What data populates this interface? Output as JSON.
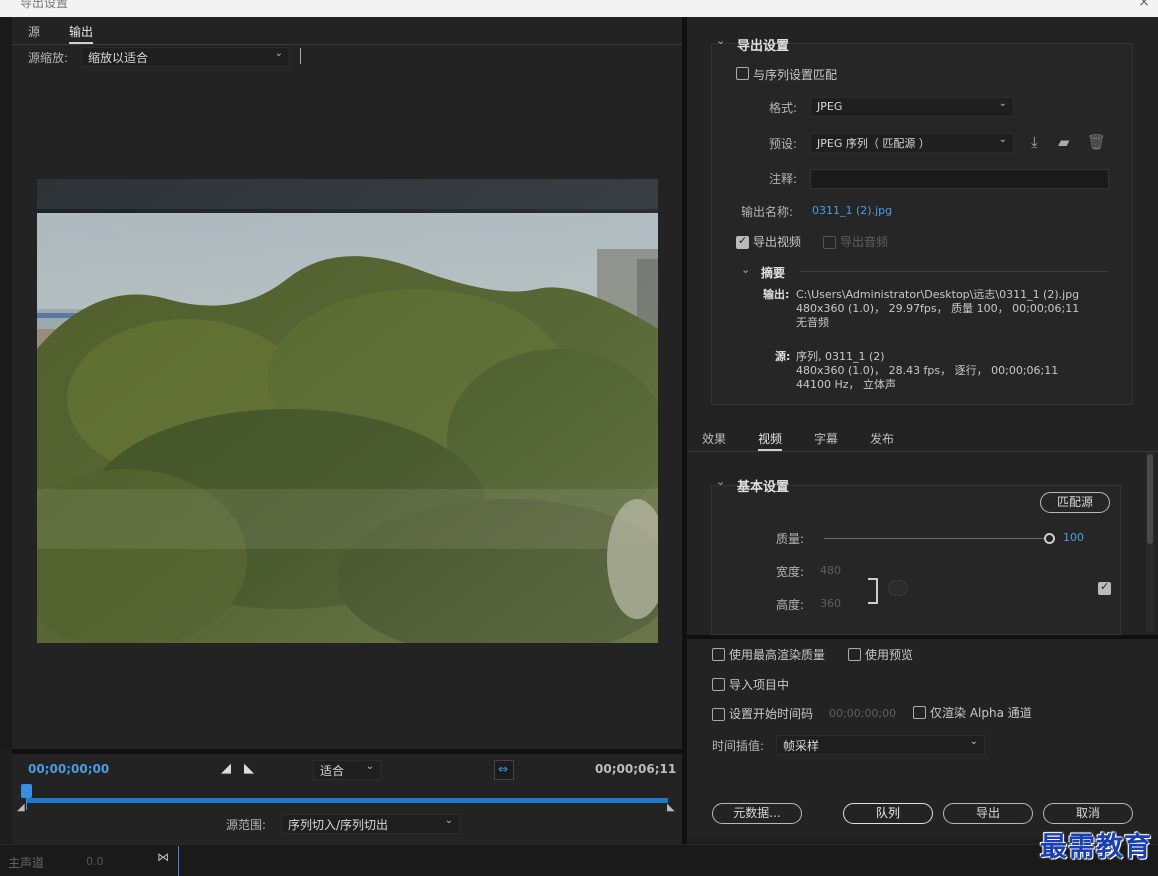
{
  "window": {
    "title": "导出设置",
    "close": "×"
  },
  "left": {
    "tabs": [
      "源",
      "输出"
    ],
    "source_scale_label": "源缩放:",
    "source_scale_value": "缩放以适合",
    "timecode_start": "00;00;00;00",
    "timecode_end": "00;00;06;11",
    "fit_value": "适合",
    "range_label": "源范围:",
    "range_value": "序列切入/序列切出"
  },
  "export": {
    "section_title": "导出设置",
    "match_sequence": "与序列设置匹配",
    "format_label": "格式:",
    "format_value": "JPEG",
    "preset_label": "预设:",
    "preset_value": "JPEG 序列（ 匹配源 ）",
    "comment_label": "注释:",
    "output_name_label": "输出名称:",
    "output_name_value": "0311_1 (2).jpg",
    "export_video": "导出视频",
    "export_audio": "导出音频",
    "summary_title": "摘要",
    "summary_output_label": "输出:",
    "summary_output_line1": "C:\\Users\\Administrator\\Desktop\\远志\\0311_1  (2).jpg",
    "summary_output_line2": "480x360  (1.0)， 29.97fps， 质量 100， 00;00;06;11",
    "summary_output_line3": "无音频",
    "summary_source_label": "源:",
    "summary_source_line1": "序列, 0311_1 (2)",
    "summary_source_line2": "480x360  (1.0)， 28.43  fps， 逐行， 00;00;06;11",
    "summary_source_line3": "44100 Hz， 立体声"
  },
  "settings_tabs": [
    "效果",
    "视频",
    "字幕",
    "发布"
  ],
  "basic": {
    "title": "基本设置",
    "match_source_btn": "匹配源",
    "quality_label": "质量:",
    "quality_value": "100",
    "width_label": "宽度:",
    "width_value": "480",
    "height_label": "高度:",
    "height_value": "360"
  },
  "bottom": {
    "max_render": "使用最高渲染质量",
    "use_preview": "使用预览",
    "import_project": "导入项目中",
    "set_start_tc": "设置开始时间码",
    "start_tc_value": "00;00;00;00",
    "alpha_only": "仅渲染 Alpha 通道",
    "interp_label": "时间插值:",
    "interp_value": "帧采样",
    "btn_metadata": "元数据...",
    "btn_queue": "队列",
    "btn_export": "导出",
    "btn_cancel": "取消"
  },
  "taskbar": {
    "master": "主声道",
    "level": "0.0"
  },
  "watermark": "最需教育",
  "colors": {
    "accent": "#4a9be4",
    "panel": "#232323",
    "timeline": "#1f78c8"
  }
}
